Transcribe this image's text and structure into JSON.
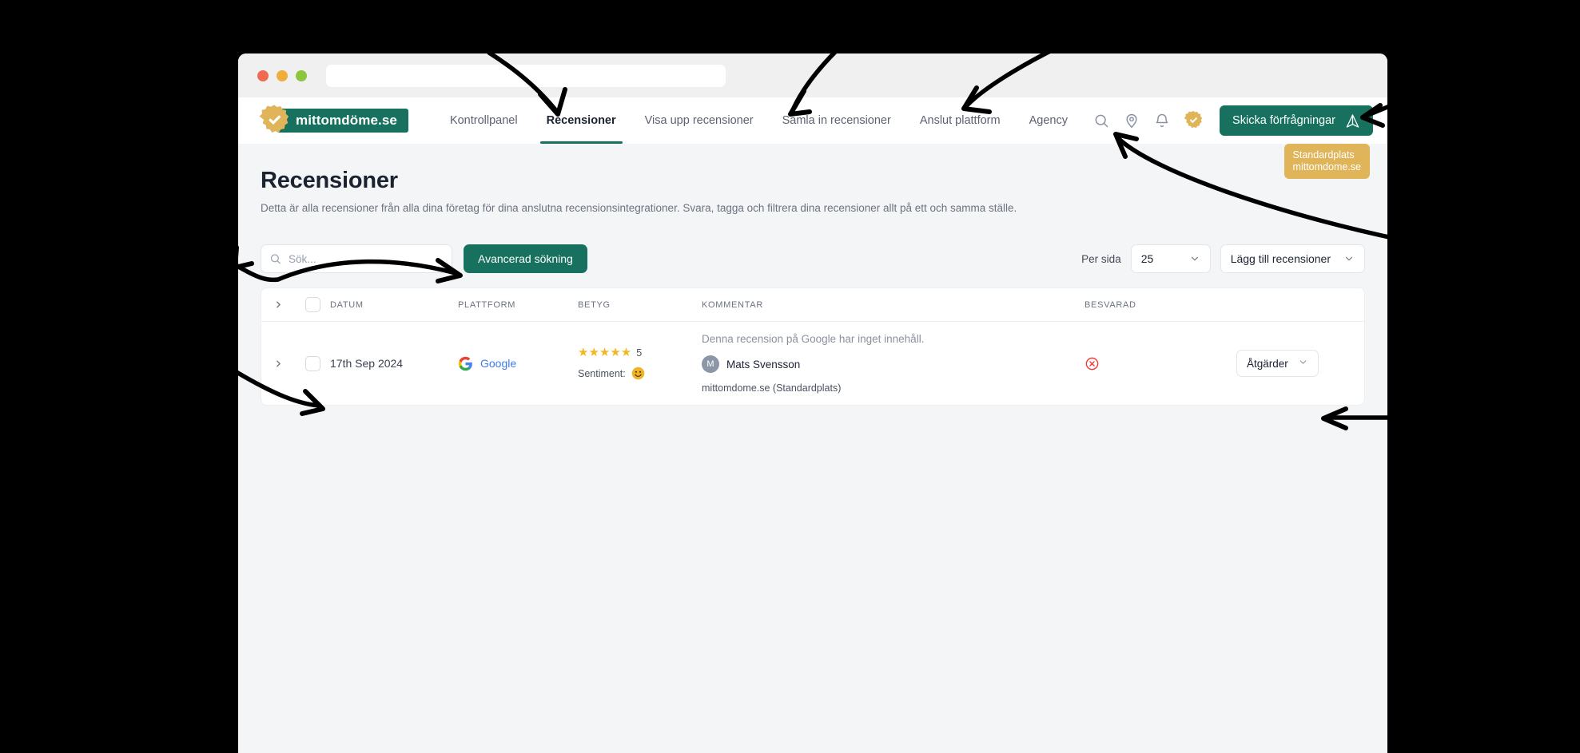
{
  "browser": {
    "dots": [
      "close-red",
      "minimize-amber",
      "maximize-green"
    ],
    "url_value": "",
    "url_placeholder": ""
  },
  "brand": {
    "name": "mittomdöme.se",
    "badge_icon": "verified-rosette-icon",
    "banner_color": "#17715e",
    "badge_color": "#e0b559"
  },
  "nav": {
    "links": [
      {
        "label": "Kontrollpanel",
        "active": false
      },
      {
        "label": "Recensioner",
        "active": true
      },
      {
        "label": "Visa upp recensioner",
        "active": false
      },
      {
        "label": "Samla in recensioner",
        "active": false
      },
      {
        "label": "Anslut plattform",
        "active": false
      },
      {
        "label": "Agency",
        "active": false
      }
    ],
    "icons": [
      "search-icon",
      "location-pin-icon",
      "bell-icon",
      "verified-badge-icon"
    ],
    "cta_label": "Skicka förfrågningar",
    "cta_icon": "send-icon",
    "accent_color": "#17715e"
  },
  "tooltip": {
    "title": "Standardplats",
    "subtitle": "mittomdome.se",
    "color": "#e0b559"
  },
  "header": {
    "title": "Recensioner",
    "subtitle": "Detta är alla recensioner från alla dina företag för dina anslutna recensionsintegrationer. Svara, tagga och filtrera dina recensioner allt på ett och samma ställe."
  },
  "toolbar": {
    "search_value": "",
    "search_placeholder": "Sök...",
    "search_icon": "search-icon",
    "advanced_search_label": "Avancerad sökning",
    "per_page_label": "Per sida",
    "per_page_value": "25",
    "add_reviews_label": "Lägg till recensioner"
  },
  "table": {
    "columns": [
      "DATUM",
      "PLATTFORM",
      "BETYG",
      "KOMMENTAR",
      "BESVARAD"
    ],
    "rows": [
      {
        "date": "17th Sep 2024",
        "platform": "Google",
        "platform_icon": "google-g-icon",
        "rating": 5,
        "rating_label": "5",
        "sentiment_label": "Sentiment:",
        "sentiment_icon": "smiley-happy-icon",
        "comment": "Denna recension på Google har inget innehåll.",
        "reviewer_initial": "M",
        "reviewer_name": "Mats Svensson",
        "source": "mittomdome.se (Standardplats)",
        "answered_icon": "circle-x-icon",
        "answered_color": "#ef3e36",
        "actions_label": "Åtgärder"
      }
    ]
  }
}
